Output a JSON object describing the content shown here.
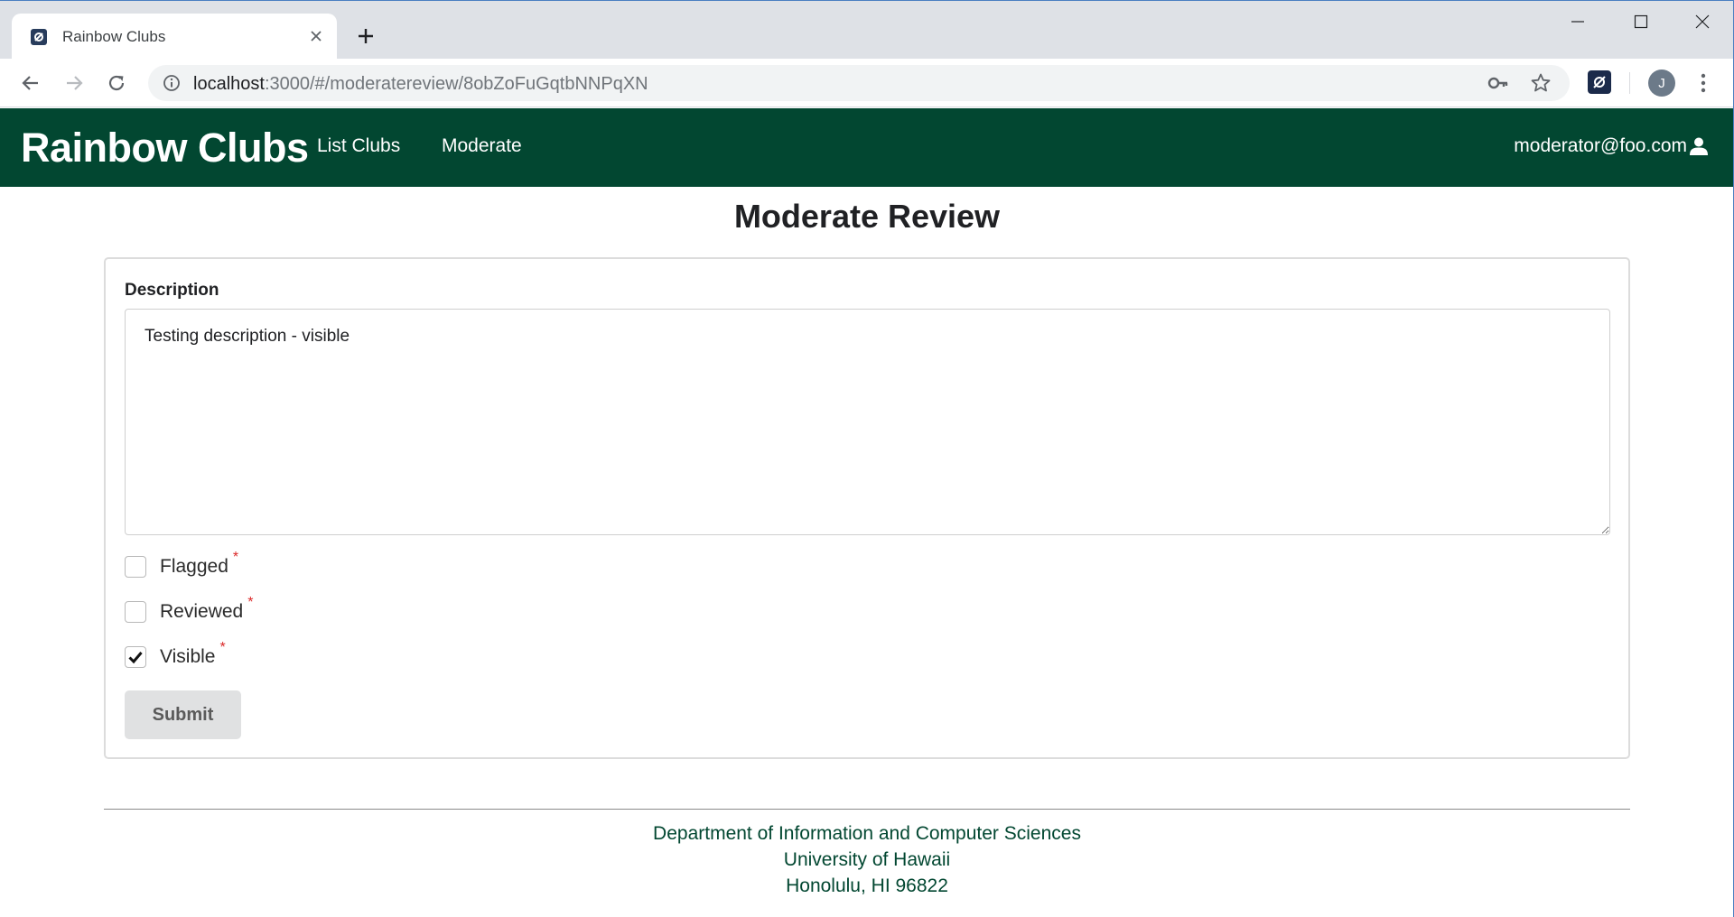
{
  "browser": {
    "tab_title": "Rainbow Clubs",
    "url_host": "localhost",
    "url_rest": ":3000/#/moderatereview/8obZoFuGqtbNNPqXN",
    "profile_initial": "J"
  },
  "navbar": {
    "brand": "Rainbow Clubs",
    "links": [
      "List Clubs",
      "Moderate"
    ],
    "user": "moderator@foo.com"
  },
  "page": {
    "title": "Moderate Review"
  },
  "form": {
    "description_label": "Description",
    "description_value": "Testing description - visible",
    "checkboxes": [
      {
        "label": "Flagged",
        "required": "*",
        "checked": false
      },
      {
        "label": "Reviewed",
        "required": "*",
        "checked": false
      },
      {
        "label": "Visible",
        "required": "*",
        "checked": true
      }
    ],
    "submit_label": "Submit"
  },
  "footer": {
    "lines": [
      "Department of Information and Computer Sciences",
      "University of Hawaii",
      "Honolulu, HI 96822"
    ]
  },
  "colors": {
    "navbar_bg": "#024731",
    "footer_text": "#024731",
    "required_mark": "#db2828"
  }
}
